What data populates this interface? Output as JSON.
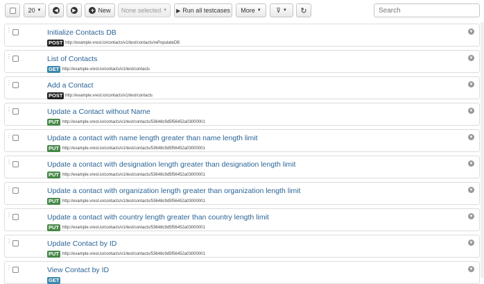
{
  "toolbar": {
    "page_size": "20",
    "new_label": "New",
    "selection_label": "None selected",
    "run_all_label": "Run all testcases",
    "more_label": "More",
    "search_placeholder": "Search"
  },
  "icons": {
    "prev": "arrow-left-circle-icon",
    "next": "arrow-right-circle-icon",
    "new": "plus-circle-icon",
    "run_all": "play-icon",
    "filter": "filter-icon",
    "refresh": "refresh-icon",
    "run_row": "arrow-down-circle-icon"
  },
  "colors": {
    "POST": "#222222",
    "GET": "#3a87ad",
    "PUT": "#468847",
    "link": "#2a6496"
  },
  "testcases": [
    {
      "title": "Initialize Contacts DB",
      "method": "POST",
      "url": "http://example.vrest.io/contacts/v1/test/contacts/rePopulateDB"
    },
    {
      "title": "List of Contacts",
      "method": "GET",
      "url": "http://example.vrest.io/contacts/v1/test/contacts"
    },
    {
      "title": "Add a Contact",
      "method": "POST",
      "url": "http://example.vrest.io/contacts/v1/test/contacts"
    },
    {
      "title": "Update a Contact without Name",
      "method": "PUT",
      "url": "http://example.vrest.io/contacts/v1/test/contacts/53648c9d5f56452a03000001"
    },
    {
      "title": "Update a contact with name length greater than name length limit",
      "method": "PUT",
      "url": "http://example.vrest.io/contacts/v1/test/contacts/53648c9d5f56452a03000001"
    },
    {
      "title": "Update a contact with designation length greater than designation length limit",
      "method": "PUT",
      "url": "http://example.vrest.io/contacts/v1/test/contacts/53648c9d5f56452a03000001"
    },
    {
      "title": "Update a contact with organization length greater than organization length limit",
      "method": "PUT",
      "url": "http://example.vrest.io/contacts/v1/test/contacts/53648c9d5f56452a03000001"
    },
    {
      "title": "Update a contact with country length greater than country length limit",
      "method": "PUT",
      "url": "http://example.vrest.io/contacts/v1/test/contacts/53648c9d5f56452a03000001"
    },
    {
      "title": "Update Contact by ID",
      "method": "PUT",
      "url": "http://example.vrest.io/contacts/v1/test/contacts/53648c9d5f56452a03000001"
    },
    {
      "title": "View Contact by ID",
      "method": "GET",
      "url": ""
    }
  ]
}
